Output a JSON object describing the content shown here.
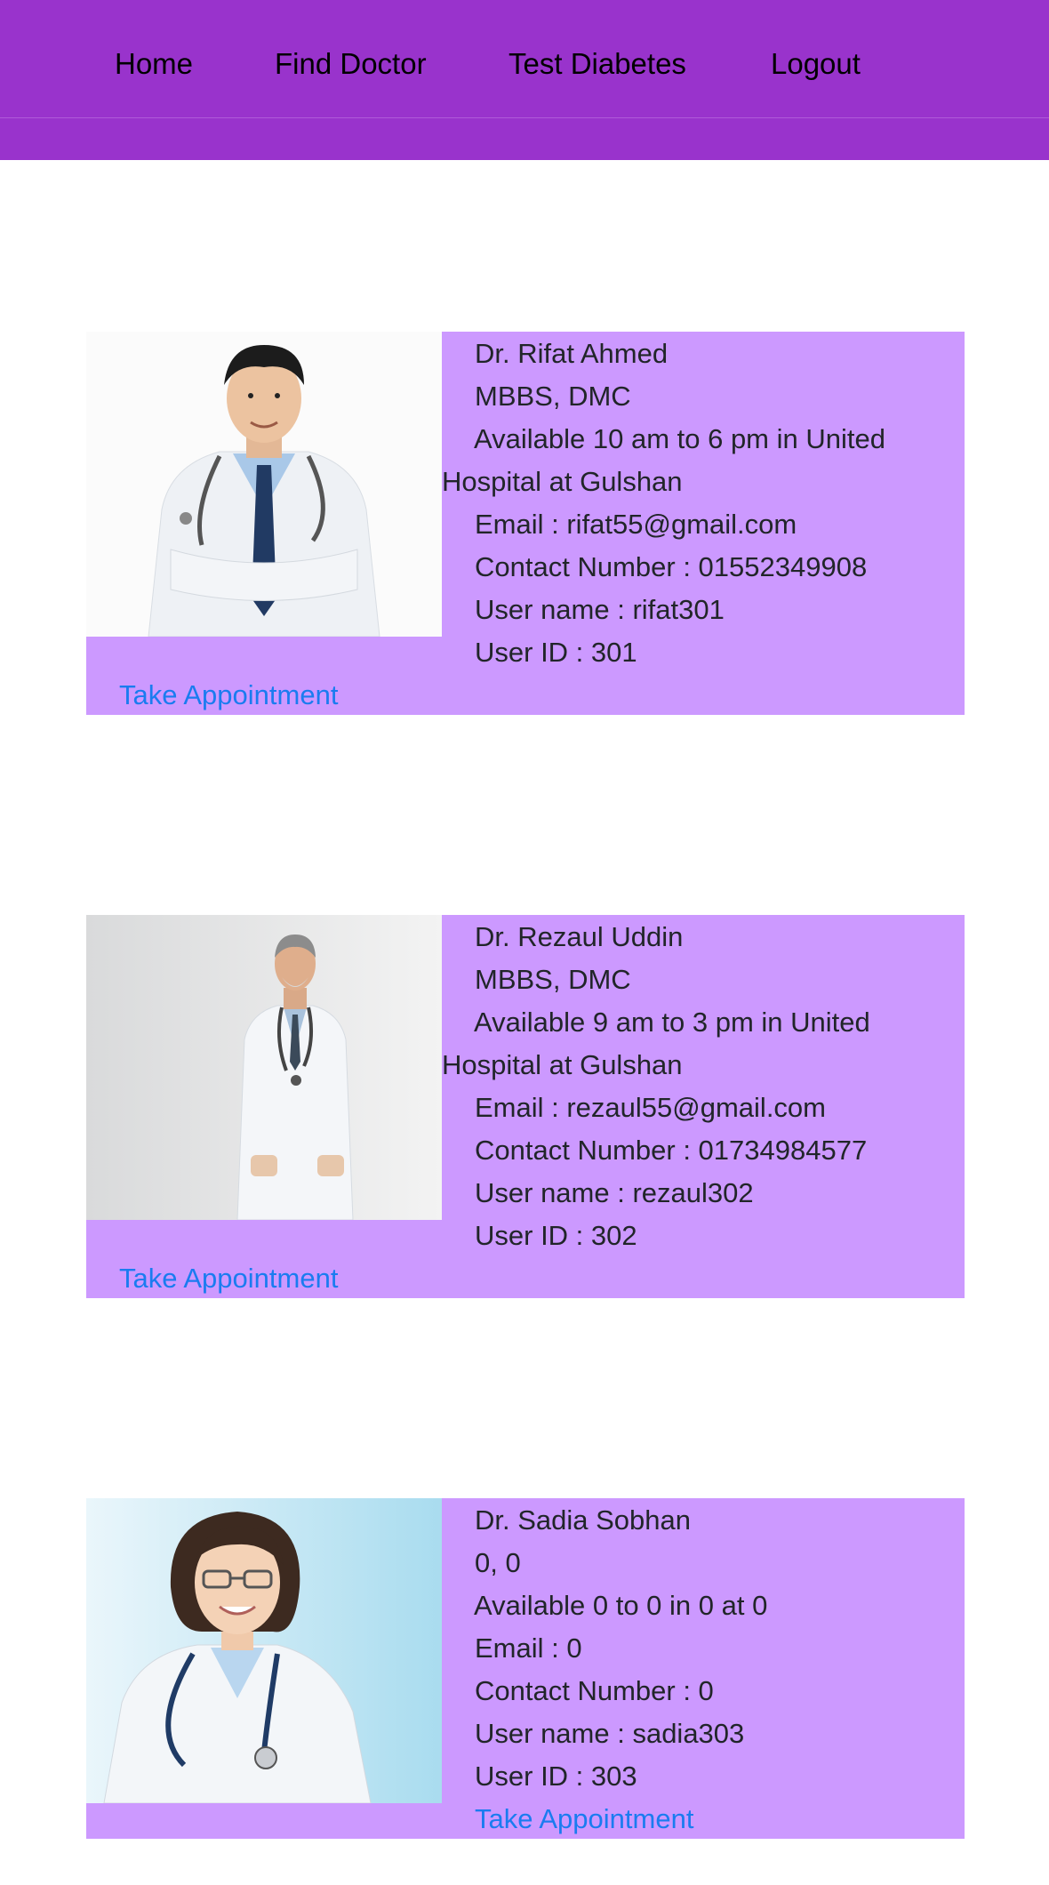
{
  "nav": {
    "items": [
      "Home",
      "Find Doctor",
      "Test Diabetes",
      "Logout"
    ]
  },
  "colors": {
    "navbar": "#9933cc",
    "card": "#cc99ff",
    "link": "#1a7cf0"
  },
  "doctors": [
    {
      "name": "Dr. Rifat Ahmed",
      "degree": "MBBS, DMC",
      "availability_line1": "Available 10 am to 6 pm in United",
      "availability_line2": "Hospital at Gulshan",
      "email": "Email : rifat55@gmail.com",
      "contact": "Contact Number : 01552349908",
      "username": "User name : rifat301",
      "user_id": "User ID : 301",
      "action": "Take Appointment",
      "photo": "doctor-photo-young-man-crossed-arms"
    },
    {
      "name": "Dr. Rezaul Uddin",
      "degree": "MBBS, DMC",
      "availability_line1": "Available 9 am to 3 pm in United",
      "availability_line2": "Hospital at Gulshan",
      "email": "Email : rezaul55@gmail.com",
      "contact": "Contact Number : 01734984577",
      "username": "User name : rezaul302",
      "user_id": "User ID : 302",
      "action": "Take Appointment",
      "photo": "doctor-photo-older-man-hands-in-pockets"
    },
    {
      "name": "Dr. Sadia Sobhan",
      "degree": "0, 0",
      "availability_line1": "Available 0 to 0 in 0 at 0",
      "email": "Email : 0",
      "contact": "Contact Number : 0",
      "username": "User name : sadia303",
      "user_id": "User ID : 303",
      "action": "Take Appointment",
      "photo": "doctor-photo-woman-with-glasses"
    }
  ]
}
